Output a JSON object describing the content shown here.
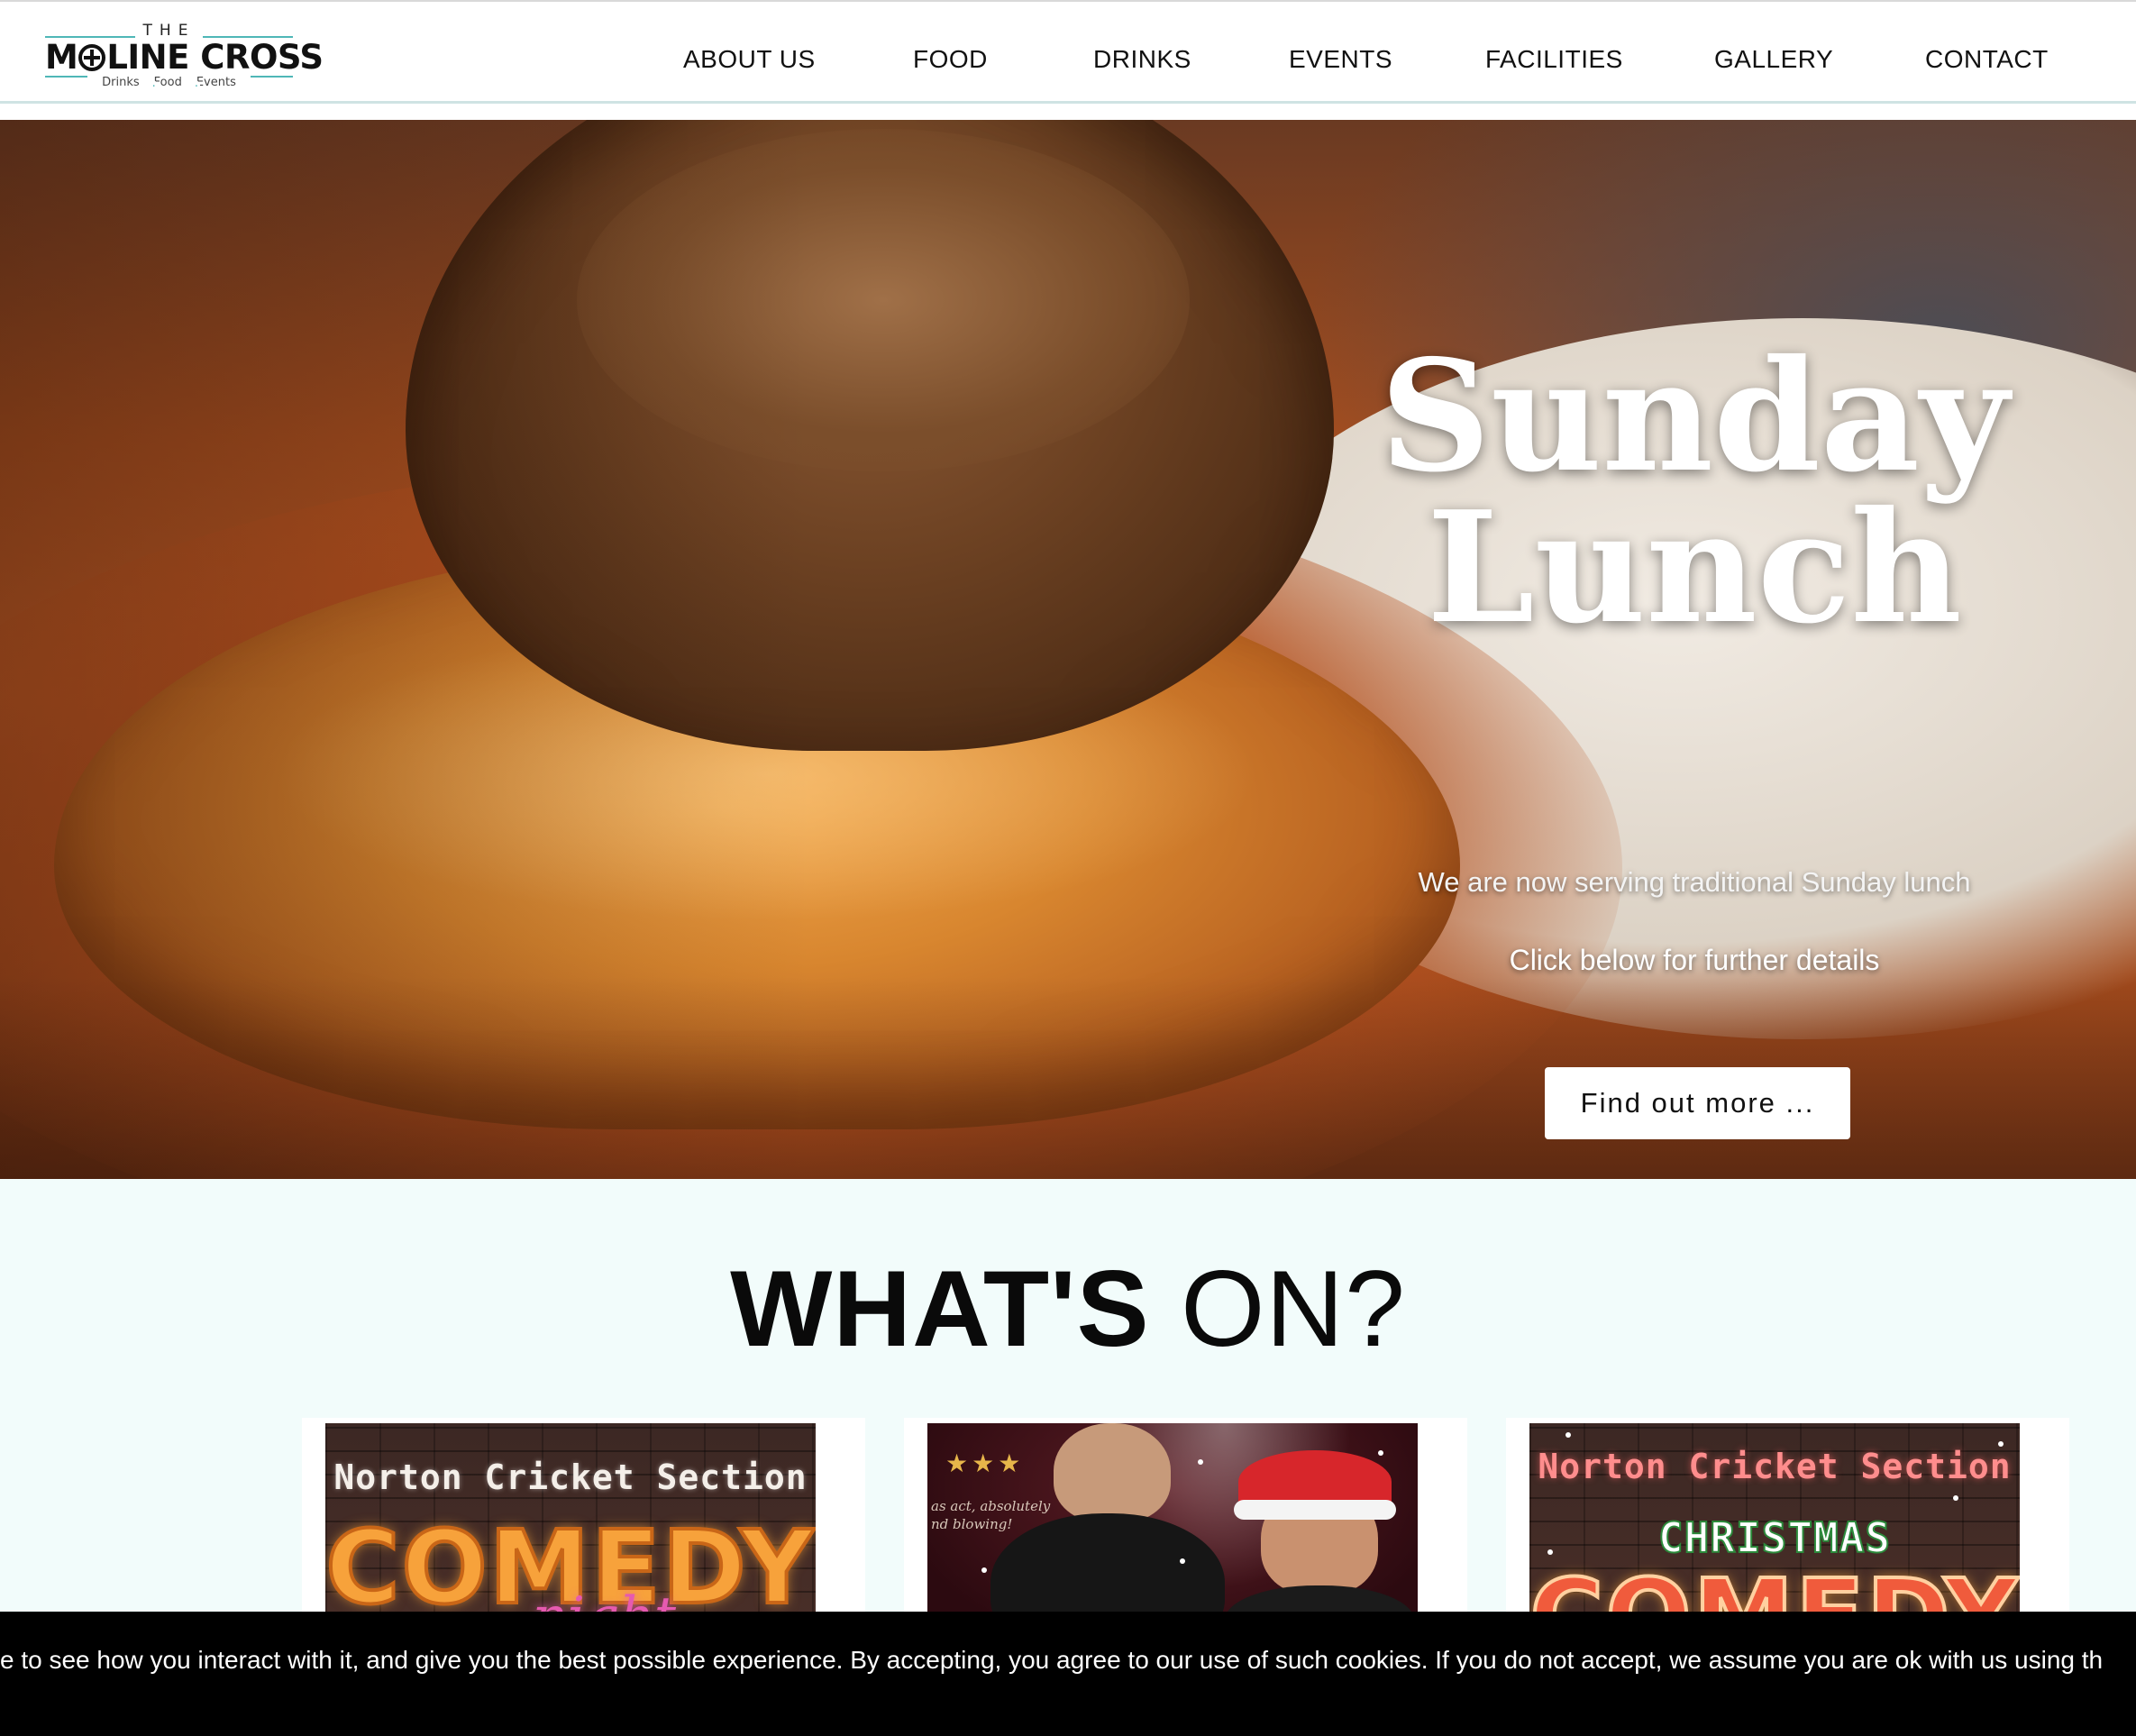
{
  "brand": {
    "the": "THE",
    "name_part1": "M",
    "name_part2": "LINE CROSS",
    "tag_drinks": "Drinks",
    "tag_food": "Food",
    "tag_events": "Events",
    "accent": "#4fb7b7"
  },
  "nav": {
    "items": [
      {
        "label": "ABOUT US"
      },
      {
        "label": "FOOD"
      },
      {
        "label": "DRINKS"
      },
      {
        "label": "EVENTS"
      },
      {
        "label": "FACILITIES"
      },
      {
        "label": "GALLERY"
      },
      {
        "label": "CONTACT"
      }
    ]
  },
  "hero": {
    "title_line1": "Sunday",
    "title_line2": "Lunch",
    "subtitle": "We are now serving traditional Sunday lunch",
    "subtitle2": "Click below for further details",
    "button_label": "Find out more ...",
    "slide_count": 7,
    "active_slide": 7
  },
  "whats_on": {
    "title_bold": "WHAT'S",
    "title_light": " ON?",
    "background": "#f2fcfb",
    "cards": [
      {
        "header": "Norton Cricket Section",
        "headline": "COMEDY",
        "script": "night"
      },
      {
        "rating": "★★★",
        "quote_line1": "as act, absolutely",
        "quote_line2": "nd blowing!"
      },
      {
        "header": "Norton Cricket Section",
        "subhead": "CHRISTMAS",
        "headline": "COMEDY"
      }
    ]
  },
  "cookie_banner": {
    "text": "ite to see how you interact with it, and give you the best possible experience. By accepting, you agree to our use of such cookies. If you do not accept, we assume you are ok with us using th"
  }
}
